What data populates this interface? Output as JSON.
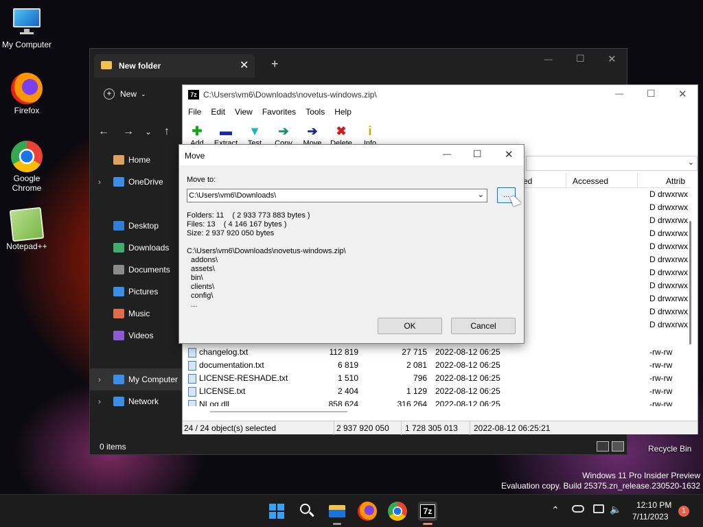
{
  "desktop": {
    "icons": [
      {
        "label": "My Computer",
        "icon": "monitor-icon"
      },
      {
        "label": "Firefox",
        "icon": "firefox-icon"
      },
      {
        "label": "Google Chrome",
        "icon": "chrome-icon"
      },
      {
        "label": "Notepad++",
        "icon": "notepadpp-icon"
      }
    ],
    "recycle_bin": "Recycle Bin",
    "watermark_line1": "Windows 11 Pro Insider Preview",
    "watermark_line2": "Evaluation copy. Build 25375.zn_release.230520-1632"
  },
  "explorer": {
    "tab_title": "New folder",
    "new_label": "New",
    "nav": [
      {
        "label": "Home",
        "icon": "home-icon",
        "color": "#e0a060"
      },
      {
        "label": "OneDrive",
        "icon": "cloud-icon",
        "color": "#3a8ee6"
      },
      {
        "label": "Desktop",
        "icon": "desktop-icon",
        "color": "#2f7fd6"
      },
      {
        "label": "Downloads",
        "icon": "download-icon",
        "color": "#3fae6c"
      },
      {
        "label": "Documents",
        "icon": "document-icon",
        "color": "#8a8a8a"
      },
      {
        "label": "Pictures",
        "icon": "picture-icon",
        "color": "#3a8ee6"
      },
      {
        "label": "Music",
        "icon": "music-icon",
        "color": "#e06c4c"
      },
      {
        "label": "Videos",
        "icon": "video-icon",
        "color": "#8d5ad6"
      },
      {
        "label": "My Computer",
        "icon": "monitor-icon",
        "color": "#3a8ee6"
      },
      {
        "label": "Network",
        "icon": "network-icon",
        "color": "#3a8ee6"
      }
    ],
    "status": "0 items"
  },
  "zip": {
    "title": "C:\\Users\\vm6\\Downloads\\novetus-windows.zip\\",
    "menu": [
      "File",
      "Edit",
      "View",
      "Favorites",
      "Tools",
      "Help"
    ],
    "toolbar": [
      {
        "label": "Add",
        "icon": "plus-icon",
        "color": "#1aa11a"
      },
      {
        "label": "Extract",
        "icon": "minus-icon",
        "color": "#1a2aa1"
      },
      {
        "label": "Test",
        "icon": "check-icon",
        "color": "#18b7c0"
      },
      {
        "label": "Copy",
        "icon": "copy-arrow-icon",
        "color": "#1b8d6c"
      },
      {
        "label": "Move",
        "icon": "move-arrow-icon",
        "color": "#1a2a7a"
      },
      {
        "label": "Delete",
        "icon": "delete-icon",
        "color": "#d41a1a"
      },
      {
        "label": "Info",
        "icon": "info-icon",
        "color": "#c8a800"
      }
    ],
    "col_headers": {
      "created": "ed",
      "accessed": "Accessed",
      "attrib": "Attrib"
    },
    "attrib_rows": [
      "D drwxrwx",
      "D drwxrwx",
      "D drwxrwx",
      "D drwxrwx",
      "D drwxrwx",
      "D drwxrwx",
      "D drwxrwx",
      "D drwxrwx",
      "D drwxrwx",
      "D drwxrwx",
      "D drwxrwx"
    ],
    "files": [
      {
        "name": "changelog.txt",
        "size": "112 819",
        "packed": "27 715",
        "modified": "2022-08-12 06:25",
        "attrib": "-rw-rw"
      },
      {
        "name": "documentation.txt",
        "size": "6 819",
        "packed": "2 081",
        "modified": "2022-08-12 06:25",
        "attrib": "-rw-rw"
      },
      {
        "name": "LICENSE-RESHADE.txt",
        "size": "1 510",
        "packed": "796",
        "modified": "2022-08-12 06:25",
        "attrib": "-rw-rw"
      },
      {
        "name": "LICENSE.txt",
        "size": "2 404",
        "packed": "1 129",
        "modified": "2022-08-12 06:25",
        "attrib": "-rw-rw"
      },
      {
        "name": "NLog.dll",
        "size": "858 624",
        "packed": "316 264",
        "modified": "2022-08-12 06:25",
        "attrib": "-rw-rw"
      }
    ],
    "extra_attrib_rows": [
      "-rw-rw"
    ],
    "status": {
      "selected": "24 / 24 object(s) selected",
      "size": "2 937 920 050",
      "packed": "1 728 305 013",
      "modified": "2022-08-12 06:25:21"
    }
  },
  "dialog": {
    "title": "Move",
    "move_to_label": "Move to:",
    "path": "C:\\Users\\vm6\\Downloads\\",
    "browse_label": "...",
    "folders": "Folders: 11    ( 2 933 773 883 bytes )",
    "files": "Files: 13    ( 4 146 167 bytes )",
    "size": "Size: 2 937 920 050 bytes",
    "archive_path": "C:\\Users\\vm6\\Downloads\\novetus-windows.zip\\",
    "items": [
      "addons\\",
      "assets\\",
      "bin\\",
      "clients\\",
      "config\\",
      "..."
    ],
    "ok": "OK",
    "cancel": "Cancel"
  },
  "taskbar": {
    "time": "12:10 PM",
    "date": "7/11/2023",
    "notification_count": "1",
    "zip_label": "7z"
  }
}
